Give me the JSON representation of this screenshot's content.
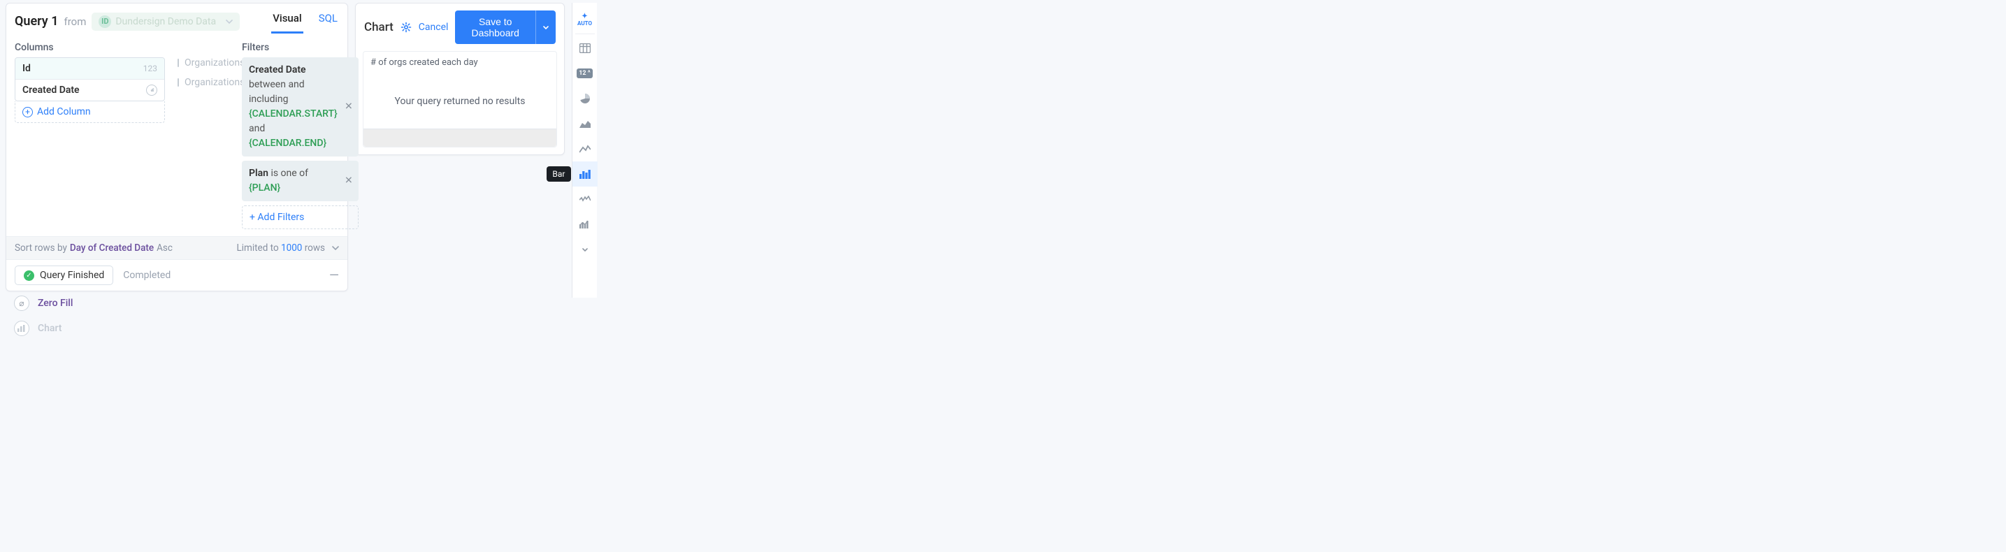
{
  "query": {
    "title": "Query 1",
    "from_label": "from",
    "source_initials": "ID",
    "source_name": "Dundersign Demo Data",
    "tabs": {
      "visual": "Visual",
      "sql": "SQL"
    }
  },
  "columns": {
    "header": "Columns",
    "rows": [
      {
        "name": "Id",
        "meta": "123",
        "source": "Organizations"
      },
      {
        "name": "Created Date",
        "meta_icon": "clock",
        "source": "Organizations"
      }
    ],
    "add_label": "Add Column"
  },
  "filters": {
    "header": "Filters",
    "items": [
      {
        "field": "Created Date",
        "op": "between and including",
        "params": [
          "{CALENDAR.START}",
          "{CALENDAR.END}"
        ],
        "joiner": "and"
      },
      {
        "field": "Plan",
        "op": "is one of",
        "params": [
          "{PLAN}"
        ]
      }
    ],
    "add_label": "+ Add Filters"
  },
  "sort": {
    "lead": "Sort rows by",
    "value": "Day of Created Date",
    "direction": "Asc",
    "limit_lead": "Limited to",
    "limit_value": "1000",
    "limit_tail": "rows"
  },
  "status": {
    "pill": "Query Finished",
    "text": "Completed"
  },
  "steps": {
    "zero_fill": "Zero Fill",
    "chart": "Chart"
  },
  "chart": {
    "title": "Chart",
    "cancel": "Cancel",
    "save": "Save to Dashboard",
    "caption": "# of orgs created each day",
    "empty": "Your query returned no results",
    "tooltip_bar": "Bar"
  },
  "rail": {
    "auto": "AUTO",
    "badge": "12 ^"
  }
}
